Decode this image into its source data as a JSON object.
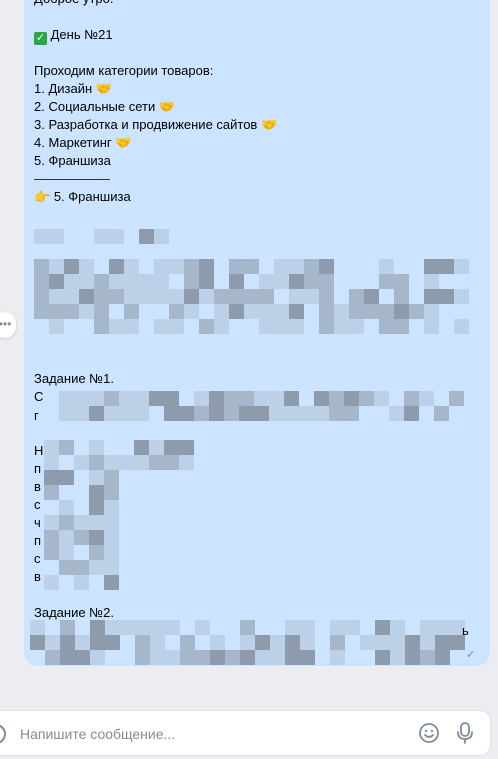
{
  "message": {
    "greeting": "Доброе утро.",
    "day_label": "День №21",
    "categories_intro": "Проходим категории товаров:",
    "categories": [
      {
        "text": "1. Дизайн",
        "emoji": "🤝"
      },
      {
        "text": "2. Социальные сети",
        "emoji": "🤝"
      },
      {
        "text": "3. Разработка и продвижение сайтов",
        "emoji": "🤝"
      },
      {
        "text": "4. Маркетинг",
        "emoji": "🤝"
      },
      {
        "text": "5. Франшиза",
        "emoji": ""
      }
    ],
    "pointer_emoji": "👉",
    "current_category": "5. Франшиза",
    "task1_title": "Задание №1.",
    "task1_first_letter": "С",
    "task1_second_letter": "г",
    "para_letters": [
      "Н",
      "п",
      "в",
      "с",
      "ч",
      "п",
      "с",
      "в"
    ],
    "task2_title": "Задание №2.",
    "task2_tail": "ь"
  },
  "composer": {
    "placeholder": "Напишите сообщение..."
  },
  "colors": {
    "bubble": "#cce4ff",
    "background": "#ebedf0",
    "icon": "#818c99",
    "blur_dark": "#8e9bad",
    "blur_mid": "#a6b7cc",
    "blur_light": "#bcd0e8"
  },
  "icons": {
    "more": "more-icon",
    "read": "checkmark-icon",
    "attach": "attach-icon",
    "smile": "smile-icon",
    "mic": "microphone-icon"
  }
}
